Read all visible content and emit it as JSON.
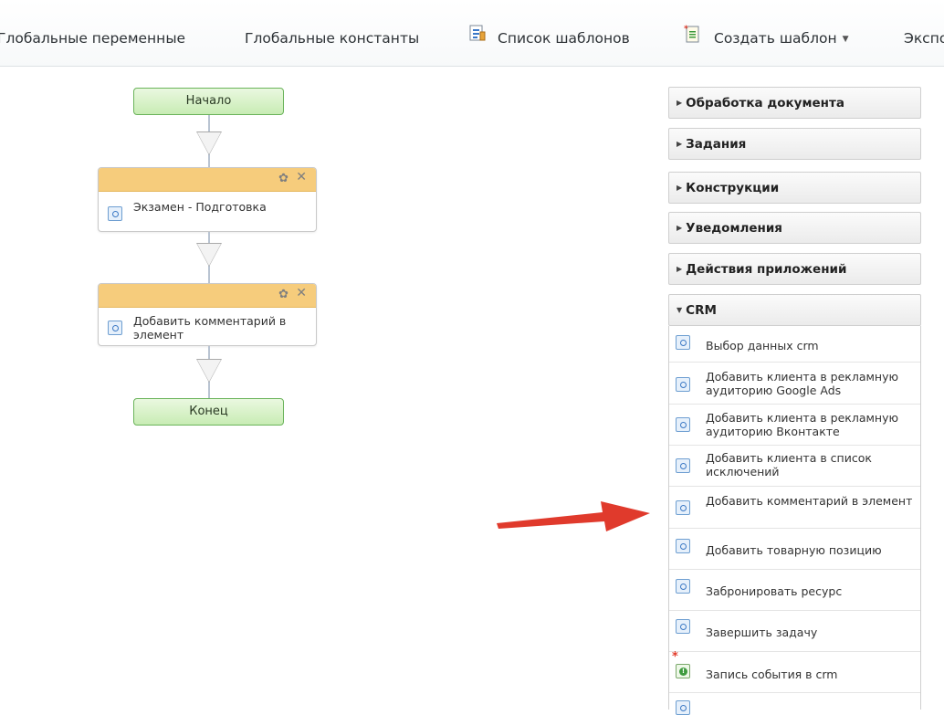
{
  "toolbar": {
    "global_variables": "Глобальные переменные",
    "global_constants": "Глобальные константы",
    "template_list": "Список шаблонов",
    "create_template": "Создать шаблон",
    "export": "Экспо",
    "template_list_icon": "list-document-icon",
    "create_template_icon": "new-document-icon"
  },
  "workflow": {
    "start_label": "Начало",
    "end_label": "Конец",
    "activities": [
      {
        "title": "Экзамен - Подготовка"
      },
      {
        "title": "Добавить комментарий в элемент"
      }
    ]
  },
  "panel": {
    "sections": [
      {
        "label": "Обработка документа",
        "expanded": false
      },
      {
        "label": "Задания",
        "expanded": false
      },
      {
        "label": "Конструкции",
        "expanded": false
      },
      {
        "label": "Уведомления",
        "expanded": false
      },
      {
        "label": "Действия приложений",
        "expanded": false
      },
      {
        "label": "CRM",
        "expanded": true
      }
    ],
    "crm_items": [
      {
        "label": "Выбор данных crm"
      },
      {
        "label": "Добавить клиента в рекламную аудиторию Google Ads"
      },
      {
        "label": "Добавить клиента в рекламную аудиторию Вконтакте"
      },
      {
        "label": "Добавить клиента в список исключений"
      },
      {
        "label": "Добавить комментарий в элемент",
        "highlighted": true
      },
      {
        "label": "Добавить товарную позицию"
      },
      {
        "label": "Забронировать ресурс"
      },
      {
        "label": "Завершить задачу"
      },
      {
        "label": "Запись события в crm",
        "icon": "event-new-icon"
      }
    ]
  },
  "colors": {
    "activity_header": "#f6cc7c",
    "terminal_fill": "#c8ecb4",
    "annotation_arrow": "#e03a2c"
  }
}
